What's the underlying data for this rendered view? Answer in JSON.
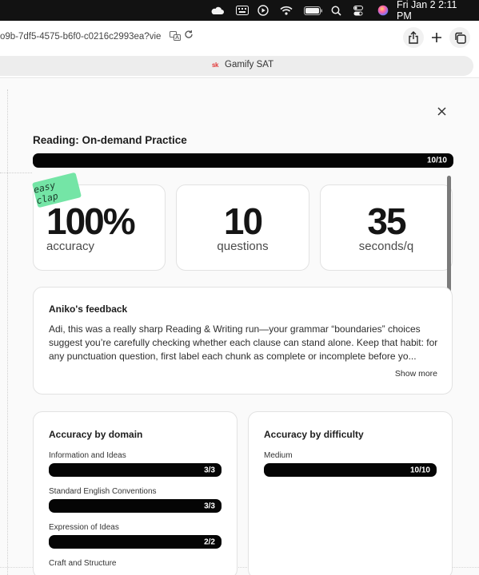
{
  "menubar": {
    "clock": "Fri Jan 2  2:11 PM",
    "icons": [
      "cloud-icon",
      "keyboard-icon",
      "play-icon",
      "wifi-icon",
      "battery-icon",
      "search-icon",
      "control-center-icon",
      "siri-icon"
    ]
  },
  "browser": {
    "url": "o9b-7df5-4575-b6f0-c0216c2993ea?vie",
    "tab_title": "Gamify SAT",
    "tab_favicon": "sk"
  },
  "page": {
    "title": "Reading: On-demand Practice",
    "progress_label": "10/10",
    "progress_fraction": 1.0,
    "sticker": "easy clap",
    "stats": {
      "accuracy_value": "100%",
      "accuracy_label": "accuracy",
      "questions_value": "10",
      "questions_label": "questions",
      "seconds_value": "35",
      "seconds_label": "seconds/q"
    },
    "feedback": {
      "title": "Aniko's feedback",
      "text": "Adi, this was a really sharp Reading & Writing run—your grammar “boundaries” choices suggest you’re carefully checking whether each clause can stand alone. Keep that habit: for any punctuation question, first label each chunk as complete or incomplete before yo...",
      "show_more": "Show more"
    },
    "domain": {
      "title": "Accuracy by domain",
      "rows": [
        {
          "label": "Information and Ideas",
          "score": "3/3",
          "fraction": 1.0
        },
        {
          "label": "Standard English Conventions",
          "score": "3/3",
          "fraction": 1.0
        },
        {
          "label": "Expression of Ideas",
          "score": "2/2",
          "fraction": 1.0
        },
        {
          "label": "Craft and Structure",
          "score": "",
          "fraction": 1.0
        }
      ]
    },
    "difficulty": {
      "title": "Accuracy by difficulty",
      "rows": [
        {
          "label": "Medium",
          "score": "10/10",
          "fraction": 1.0
        }
      ]
    }
  }
}
